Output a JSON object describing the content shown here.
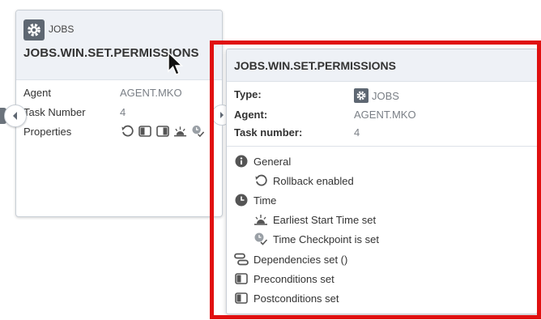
{
  "card": {
    "type_label": "JOBS",
    "title": "JOBS.WIN.SET.PERMISSIONS",
    "rows": [
      {
        "label": "Agent",
        "value": "AGENT.MKO"
      },
      {
        "label": "Task Number",
        "value": "4"
      },
      {
        "label": "Properties",
        "value": ""
      }
    ],
    "property_icons": [
      "rollback-icon",
      "precondition-icon",
      "postcondition-icon",
      "earliest-start-icon",
      "time-checkpoint-icon"
    ]
  },
  "tooltip": {
    "title": "JOBS.WIN.SET.PERMISSIONS",
    "type_label": "Type:",
    "type_value": "JOBS",
    "agent_label": "Agent:",
    "agent_value": "AGENT.MKO",
    "task_label": "Task number:",
    "task_value": "4",
    "sections": {
      "general": "General",
      "rollback": "Rollback enabled",
      "time": "Time",
      "earliest": "Earliest Start Time set",
      "checkpoint": "Time Checkpoint is set",
      "dependencies": "Dependencies set ()",
      "preconditions": "Preconditions set",
      "postconditions": "Postconditions set"
    }
  },
  "colors": {
    "highlight": "#e01010",
    "header_bg": "#eef1f6",
    "badge": "#5e6772"
  }
}
